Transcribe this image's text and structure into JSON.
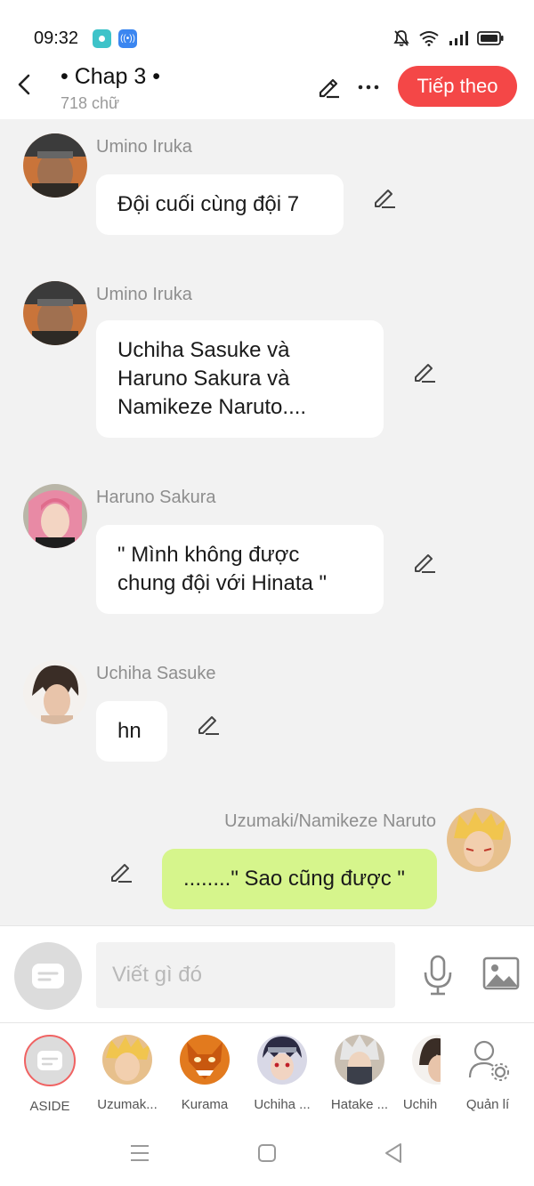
{
  "status_bar": {
    "time": "09:32",
    "app_icon_1": "app-badge-icon",
    "app_icon_2": "wifi-badge-icon",
    "right_icons": [
      "bell-off-icon",
      "wifi-icon",
      "signal-icon",
      "battery-icon"
    ]
  },
  "header": {
    "title": "• Chap 3 •",
    "word_count": "718 chữ",
    "next_label": "Tiếp theo",
    "accent": "#f44747"
  },
  "messages": [
    {
      "sender": "Umino Iruka",
      "text": "Đội cuối cùng đội 7",
      "side": "left"
    },
    {
      "sender": "Umino Iruka",
      "text": "Uchiha Sasuke và Haruno Sakura và Namikeze Naruto....",
      "side": "left"
    },
    {
      "sender": "Haruno Sakura",
      "text": "\" Mình không được chung đội với Hinata \"",
      "side": "left"
    },
    {
      "sender": "Uchiha Sasuke",
      "text": "hn",
      "side": "left"
    },
    {
      "sender": "Uzumaki/Namikeze Naruto",
      "text": "........\" Sao cũng được \"",
      "side": "right"
    }
  ],
  "input": {
    "placeholder": "Viết gì đó"
  },
  "characters": [
    {
      "label": "ASIDE"
    },
    {
      "label": "Uzumak..."
    },
    {
      "label": "Kurama"
    },
    {
      "label": "Uchiha ..."
    },
    {
      "label": "Hatake ..."
    },
    {
      "label": "Uchih"
    },
    {
      "label": "Quản lí"
    }
  ],
  "colors": {
    "chat_bg": "#f2f2f2",
    "my_bubble": "#d6f58c",
    "other_bubble": "#ffffff"
  }
}
